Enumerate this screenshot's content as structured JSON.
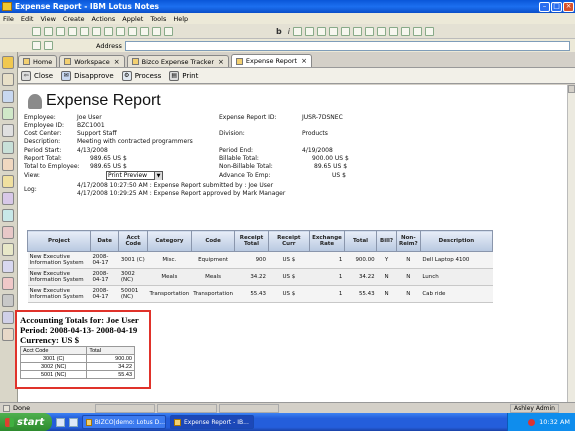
{
  "window": {
    "title": "Expense Report - IBM Lotus Notes"
  },
  "menu": [
    "File",
    "Edit",
    "View",
    "Create",
    "Actions",
    "Applet",
    "Tools",
    "Help"
  ],
  "toolbar": {
    "bold": "b",
    "italic": "i"
  },
  "address": {
    "label": "Address",
    "value": ""
  },
  "tabs": [
    {
      "label": "Home"
    },
    {
      "label": "Workspace"
    },
    {
      "label": "Bizco Expense Tracker"
    },
    {
      "label": "Expense Report"
    }
  ],
  "actions": {
    "close": "Close",
    "disapprove": "Disapprove",
    "process": "Process",
    "print": "Print"
  },
  "report": {
    "heading": "Expense Report",
    "employee_label": "Employee:",
    "employee": "Joe User",
    "employee_id_label": "Employee ID:",
    "employee_id": "BZC1001",
    "cost_center_label": "Cost Center:",
    "cost_center": "Support Staff",
    "description_label": "Description:",
    "description": "Meeting with contracted programmers",
    "period_start_label": "Period Start:",
    "period_start": "4/13/2008",
    "report_total_label": "Report Total:",
    "report_total": "989.65 US $",
    "total_to_employee_label": "Total to Employee:",
    "total_to_employee": "989.65 US $",
    "view_label": "View:",
    "view_value": "Print Preview",
    "log_label": "Log:",
    "log1": "4/17/2008 10:27:50 AM : Expense Report submitted by : Joe User",
    "log2": "4/17/2008 10:29:25 AM : Expense Report approved by Mark Manager",
    "report_id_label": "Expense Report ID:",
    "report_id": "JUSR-7DSNEC",
    "division_label": "Division:",
    "division": "Products",
    "period_end_label": "Period End:",
    "period_end": "4/19/2008",
    "billable_label": "Billable Total:",
    "billable": "900.00 US $",
    "non_billable_label": "Non-Billable Total:",
    "non_billable": "89.65 US $",
    "advance_label": "Advance To Emp:",
    "advance": "US $"
  },
  "expense_table": {
    "headers": [
      "Project",
      "Date",
      "Acct Code",
      "Category",
      "Code",
      "Receipt Total",
      "Receipt Curr",
      "Exchange Rate",
      "Total",
      "Bill?",
      "Non-Reim?",
      "Description"
    ],
    "rows": [
      [
        "New Executive Information System",
        "2008-04-17",
        "3001 (C)",
        "Misc.",
        "Equipment",
        "900",
        "US $",
        "1",
        "900.00",
        "Y",
        "N",
        "Dell Laptop 4100"
      ],
      [
        "New Executive Information System",
        "2008-04-17",
        "3002 (NC)",
        "Meals",
        "Meals",
        "34.22",
        "US $",
        "1",
        "34.22",
        "N",
        "N",
        "Lunch"
      ],
      [
        "New Executive Information System",
        "2008-04-17",
        "50001 (NC)",
        "Transportation",
        "Transportation",
        "55.43",
        "US $",
        "1",
        "55.43",
        "N",
        "N",
        "Cab ride"
      ]
    ]
  },
  "accounting": {
    "line1": "Accounting Totals for: Joe User",
    "line2": "Period: 2008-04-13- 2008-04-19",
    "line3": "Currency: US $",
    "headers": [
      "Acct Code",
      "Total"
    ],
    "rows": [
      [
        "3001 (C)",
        "900.00"
      ],
      [
        "3002 (NC)",
        "34.22"
      ],
      [
        "5001 (NC)",
        "55.43"
      ]
    ]
  },
  "status": {
    "text": "Done",
    "user": "Ashley Admin"
  },
  "taskbar": {
    "start": "start",
    "tasks": [
      "BIZCO|demo: Lotus D...",
      "Expense Report - IB..."
    ],
    "clock": "10:32 AM"
  },
  "colors": {
    "highlight_box": "#e0322a",
    "title_bar": "#0a56d8",
    "table_header": "#b8c8e0"
  }
}
